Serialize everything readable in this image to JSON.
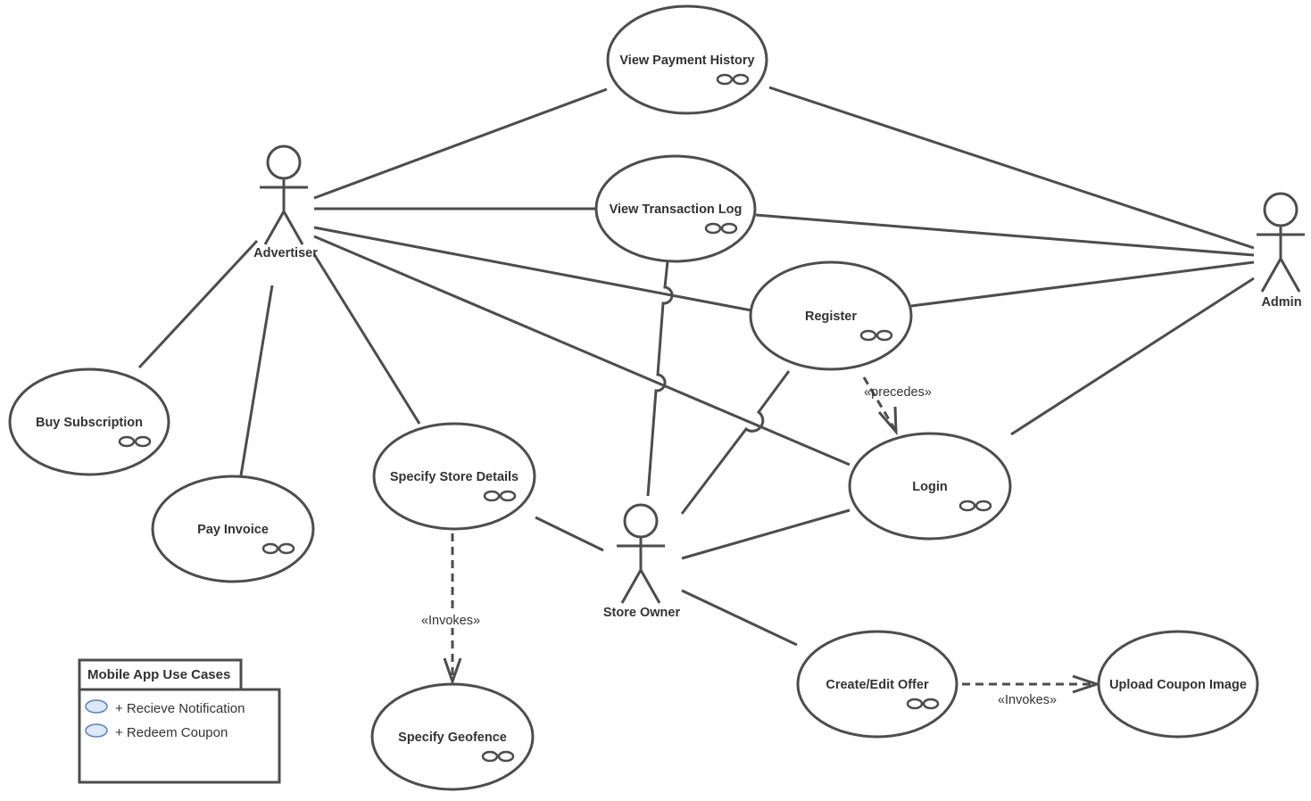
{
  "actors": {
    "advertiser": "Advertiser",
    "admin": "Admin",
    "store_owner": "Store Owner"
  },
  "use_cases": {
    "view_payment_history": "View Payment History",
    "view_transaction_log": "View Transaction Log",
    "register": "Register",
    "login": "Login",
    "buy_subscription": "Buy Subscription",
    "pay_invoice": "Pay Invoice",
    "specify_store_details": "Specify Store Details",
    "specify_geofence": "Specify Geofence",
    "create_edit_offer": "Create/Edit Offer",
    "upload_coupon_image": "Upload Coupon Image"
  },
  "relations": {
    "precedes": "«precedes»",
    "invokes_geofence": "«Invokes»",
    "invokes_upload": "«Invokes»"
  },
  "package": {
    "title": "Mobile App Use Cases",
    "items": [
      "+ Recieve Notification",
      "+ Redeem Coupon"
    ],
    "item_icon_fill": "#dde8f8",
    "item_icon_stroke": "#5a7fc8"
  }
}
